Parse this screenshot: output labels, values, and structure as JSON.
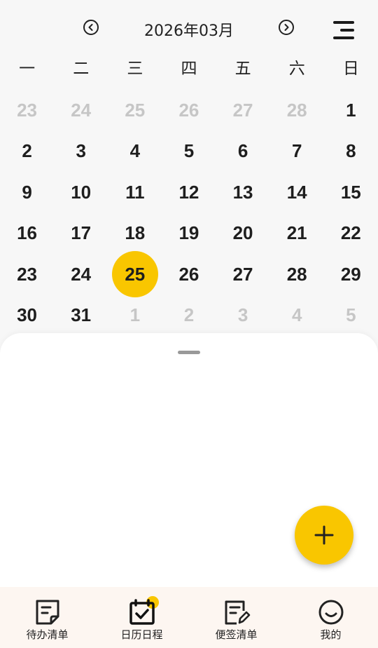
{
  "header": {
    "month_title": "2026年03月",
    "prev_icon": "chevron-left-circle-icon",
    "next_icon": "chevron-right-circle-icon",
    "menu_icon": "menu-icon"
  },
  "weekdays": [
    "一",
    "二",
    "三",
    "四",
    "五",
    "六",
    "日"
  ],
  "days": [
    {
      "label": "23",
      "muted": true
    },
    {
      "label": "24",
      "muted": true
    },
    {
      "label": "25",
      "muted": true
    },
    {
      "label": "26",
      "muted": true
    },
    {
      "label": "27",
      "muted": true
    },
    {
      "label": "28",
      "muted": true
    },
    {
      "label": "1",
      "muted": false
    },
    {
      "label": "2",
      "muted": false
    },
    {
      "label": "3",
      "muted": false
    },
    {
      "label": "4",
      "muted": false
    },
    {
      "label": "5",
      "muted": false
    },
    {
      "label": "6",
      "muted": false
    },
    {
      "label": "7",
      "muted": false
    },
    {
      "label": "8",
      "muted": false
    },
    {
      "label": "9",
      "muted": false
    },
    {
      "label": "10",
      "muted": false
    },
    {
      "label": "11",
      "muted": false
    },
    {
      "label": "12",
      "muted": false
    },
    {
      "label": "13",
      "muted": false
    },
    {
      "label": "14",
      "muted": false
    },
    {
      "label": "15",
      "muted": false
    },
    {
      "label": "16",
      "muted": false
    },
    {
      "label": "17",
      "muted": false
    },
    {
      "label": "18",
      "muted": false
    },
    {
      "label": "19",
      "muted": false
    },
    {
      "label": "20",
      "muted": false
    },
    {
      "label": "21",
      "muted": false
    },
    {
      "label": "22",
      "muted": false
    },
    {
      "label": "23",
      "muted": false
    },
    {
      "label": "24",
      "muted": false
    },
    {
      "label": "25",
      "muted": false,
      "today": true
    },
    {
      "label": "26",
      "muted": false
    },
    {
      "label": "27",
      "muted": false
    },
    {
      "label": "28",
      "muted": false
    },
    {
      "label": "29",
      "muted": false
    },
    {
      "label": "30",
      "muted": false
    },
    {
      "label": "31",
      "muted": false
    },
    {
      "label": "1",
      "muted": true
    },
    {
      "label": "2",
      "muted": true
    },
    {
      "label": "3",
      "muted": true
    },
    {
      "label": "4",
      "muted": true
    },
    {
      "label": "5",
      "muted": true
    }
  ],
  "fab": {
    "icon": "plus-icon"
  },
  "tabs": [
    {
      "label": "待办清单",
      "icon": "todo-list-icon"
    },
    {
      "label": "日历日程",
      "icon": "calendar-check-icon",
      "active": true
    },
    {
      "label": "便签清单",
      "icon": "note-edit-icon"
    },
    {
      "label": "我的",
      "icon": "smile-icon"
    }
  ],
  "colors": {
    "accent": "#f9c600",
    "muted": "#c6c6c6",
    "tabbar_bg": "#fdf6f1"
  }
}
